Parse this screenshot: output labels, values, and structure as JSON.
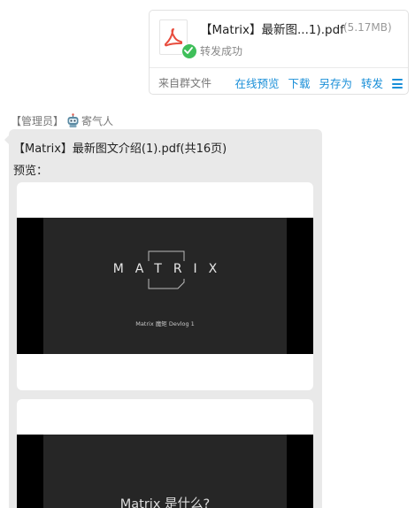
{
  "file_card": {
    "file_name": "【Matrix】最新图...1).pdf",
    "file_size": "(5.17MB)",
    "status": "转发成功",
    "source": "来自群文件",
    "actions": [
      "在线预览",
      "下载",
      "另存为",
      "转发"
    ],
    "file_icon": "pdf-icon",
    "status_icon": "check-icon",
    "menu_icon": "menu-icon",
    "colors": {
      "action": "#1a8fd8",
      "pdf": "#e84c3d",
      "success": "#3fbf5a"
    }
  },
  "sender": {
    "role": "【管理员】",
    "name": "寄气人",
    "avatar_icon": "robot-icon"
  },
  "message": {
    "title": "【Matrix】最新图文介绍(1).pdf(共16页)",
    "preview_label": "预览：",
    "pages": [
      {
        "logo": "MATRIX",
        "subtitle": "Matrix 魔矩 Devlog 1"
      },
      {
        "heading": "Matrix 是什么?"
      }
    ]
  }
}
